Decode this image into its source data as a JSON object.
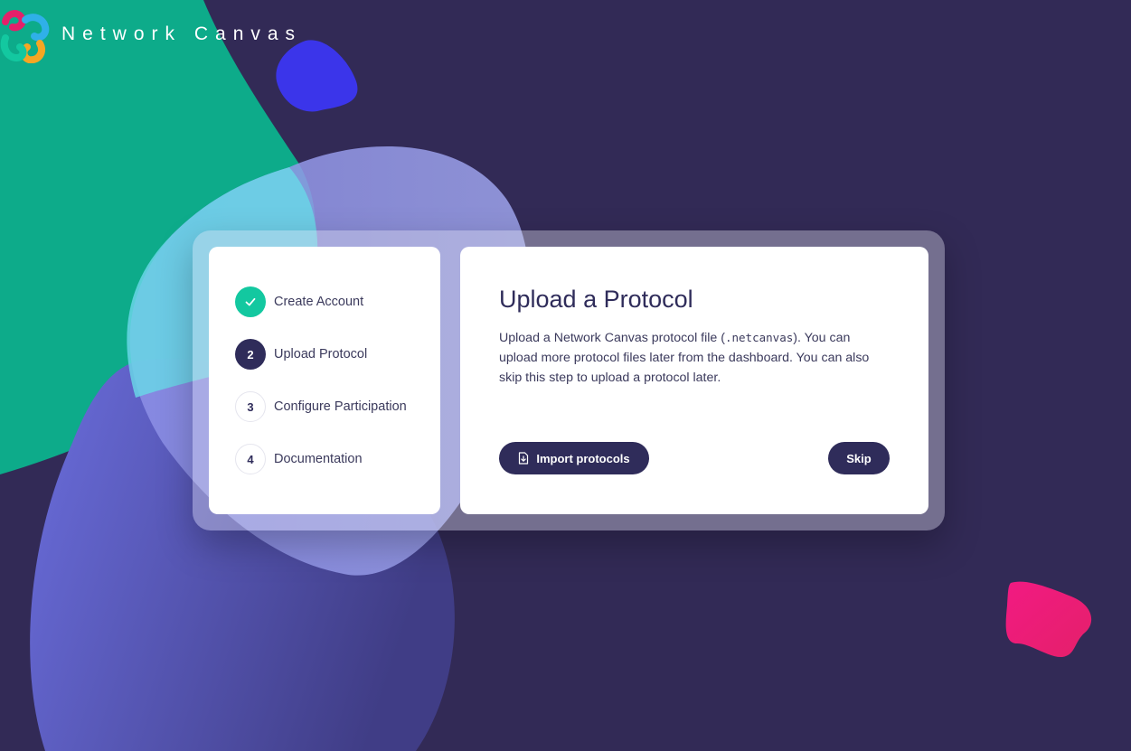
{
  "brand": {
    "name": "Network Canvas",
    "logo_icon": "network-canvas-logo-icon"
  },
  "wizard": {
    "steps": [
      {
        "marker": "",
        "label": "Create Account",
        "status": "done"
      },
      {
        "marker": "2",
        "label": "Upload Protocol",
        "status": "active"
      },
      {
        "marker": "3",
        "label": "Configure Participation",
        "status": "pending"
      },
      {
        "marker": "4",
        "label": "Documentation",
        "status": "pending"
      }
    ],
    "content": {
      "title": "Upload a Protocol",
      "desc_before": "Upload a Network Canvas protocol file (",
      "desc_code": ".netcanvas",
      "desc_after": "). You can upload more protocol files later from the dashboard. You can also skip this step to upload a protocol later.",
      "import_label": "Import protocols",
      "import_icon": "file-import-icon",
      "skip_label": "Skip"
    }
  },
  "colors": {
    "background": "#322a56",
    "primary": "#2f2c5a",
    "success": "#13c8a0",
    "blob_green": "#0dab8a",
    "blob_purple": "#6d6fd8",
    "blob_blue": "#3b35ea",
    "blob_pink": "#ee1c79"
  }
}
